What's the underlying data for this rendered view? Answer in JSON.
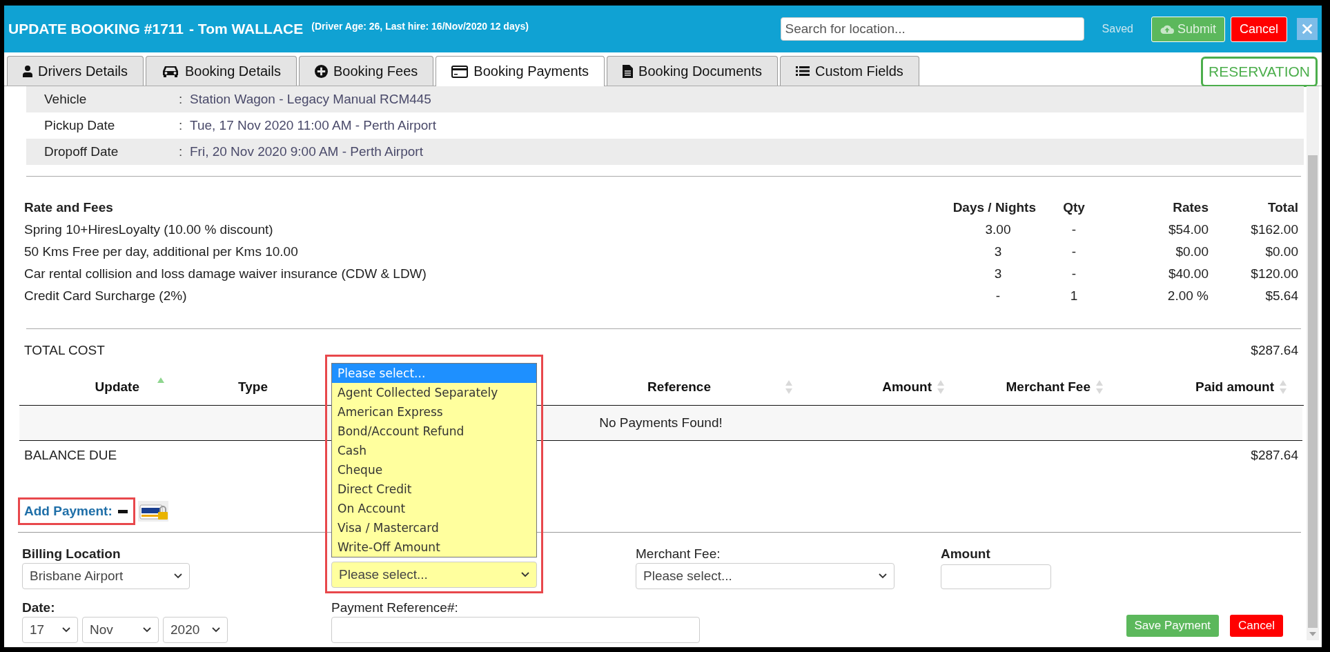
{
  "header": {
    "title": "UPDATE BOOKING #1711",
    "driver_name": "- Tom WALLACE",
    "driver_info": "(Driver Age: 26, Last hire: 16/Nov/2020 12 days)",
    "search": {
      "placeholder": "Search for location..."
    },
    "save_status": "Saved",
    "buttons": [
      {
        "label": "Submit",
        "kind": "submit"
      },
      {
        "label": "Cancel",
        "kind": "cancel"
      }
    ]
  },
  "tabs": [
    {
      "label": "Drivers Details",
      "selected": false
    },
    {
      "label": "Booking Details",
      "selected": false
    },
    {
      "label": "Booking Fees",
      "selected": false
    },
    {
      "label": "Booking Payments",
      "selected": true
    },
    {
      "label": "Booking Documents",
      "selected": false
    },
    {
      "label": "Custom Fields",
      "selected": false
    }
  ],
  "status_badge": "RESERVATION",
  "booking_info": [
    {
      "label": "Vehicle",
      "separator": ":",
      "value": "Station Wagon - Legacy Manual RCM445"
    },
    {
      "label": "Pickup Date",
      "separator": ":",
      "value": "Tue, 17 Nov 2020 11:00 AM - Perth Airport"
    },
    {
      "label": "Dropoff Date",
      "separator": ":",
      "value": "Fri, 20 Nov 2020 9:00 AM - Perth Airport"
    }
  ],
  "fees": {
    "columns": [
      "Rate and Fees",
      "Days / Nights",
      "Qty",
      "Rates",
      "Total"
    ],
    "rows": [
      {
        "description": "Spring 10+HiresLoyalty (10.00 % discount)",
        "days": "3.00",
        "qty": "-",
        "rate": "$54.00",
        "total": "$162.00"
      },
      {
        "description": "50 Kms Free per day, additional per Kms 10.00",
        "days": "3",
        "qty": "-",
        "rate": "$0.00",
        "total": "$0.00"
      },
      {
        "description": "Car rental collision and loss damage waiver insurance (CDW & LDW)",
        "days": "3",
        "qty": "-",
        "rate": "$40.00",
        "total": "$120.00"
      },
      {
        "description": "Credit Card Surcharge (2%)",
        "days": "-",
        "qty": "1",
        "rate": "2.00 %",
        "total": "$5.64"
      }
    ]
  },
  "total_cost": {
    "label": "TOTAL COST",
    "value": "$287.64"
  },
  "payments": {
    "columns": [
      {
        "label": "Update",
        "kind": "sorted"
      },
      {
        "label": "Type",
        "kind": "plain"
      },
      {
        "label": "Reference",
        "kind": "sortable"
      },
      {
        "label": "Amount",
        "kind": "sortable"
      },
      {
        "label": "Merchant Fee",
        "kind": "sortable"
      },
      {
        "label": "Paid amount",
        "kind": "sortable"
      }
    ],
    "empty_message": "No Payments Found!"
  },
  "balance_due": {
    "label": "BALANCE DUE",
    "value": "$287.64"
  },
  "add_payment": {
    "label": "Add Payment:"
  },
  "form": {
    "billing_location": {
      "label": "Billing Location",
      "value": "Brisbane Airport"
    },
    "date": {
      "label": "Date:",
      "day": "17",
      "month": "Nov",
      "year": "2020"
    },
    "payment_type": {
      "value": "Please select...",
      "options": [
        {
          "label": "Please select...",
          "selected": true
        },
        {
          "label": "Agent Collected Separately",
          "selected": false
        },
        {
          "label": "American Express",
          "selected": false
        },
        {
          "label": "Bond/Account Refund",
          "selected": false
        },
        {
          "label": "Cash",
          "selected": false
        },
        {
          "label": "Cheque",
          "selected": false
        },
        {
          "label": "Direct Credit",
          "selected": false
        },
        {
          "label": "On Account",
          "selected": false
        },
        {
          "label": "Visa / Mastercard",
          "selected": false
        },
        {
          "label": "Write-Off Amount",
          "selected": false
        }
      ]
    },
    "merchant_fee": {
      "label": "Merchant Fee:",
      "value": "Please select..."
    },
    "amount": {
      "label": "Amount"
    },
    "payment_reference": {
      "label": "Payment Reference#:"
    },
    "buttons": [
      {
        "label": "Save Payment",
        "kind": "save"
      },
      {
        "label": "Cancel",
        "kind": "cancel"
      }
    ]
  }
}
